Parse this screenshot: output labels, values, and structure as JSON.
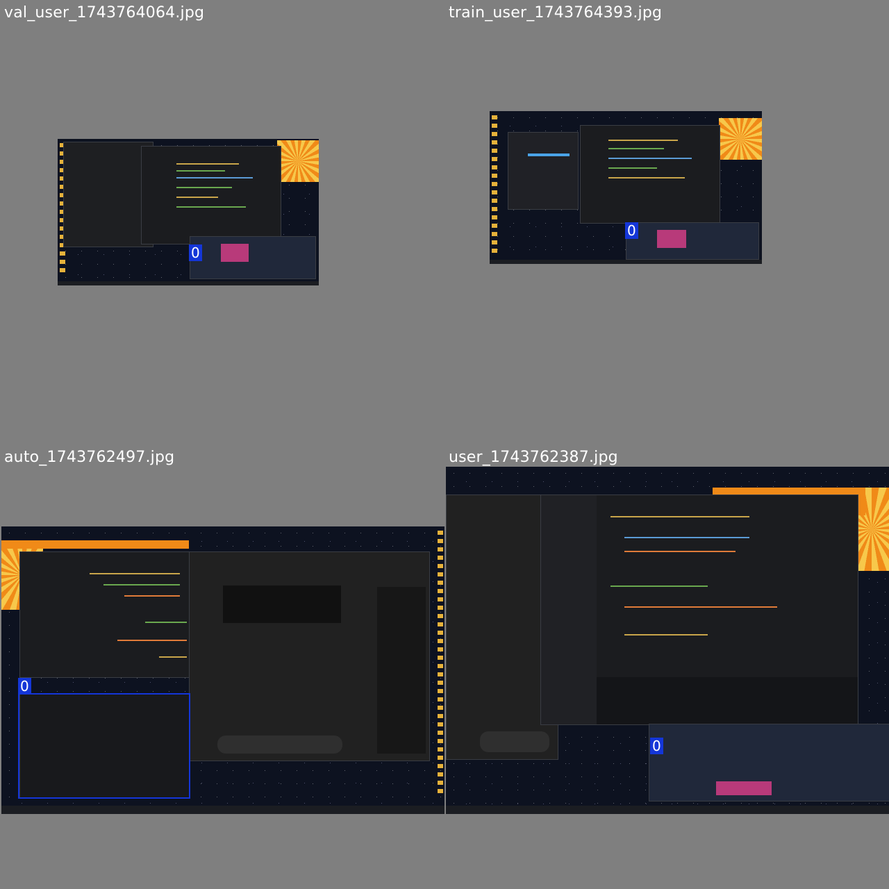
{
  "tiles": [
    {
      "caption": "val_user_1743764064.jpg",
      "box_label": "0"
    },
    {
      "caption": "train_user_1743764393.jpg",
      "box_label": "0"
    },
    {
      "caption": "auto_1743762497.jpg",
      "box_label": "0"
    },
    {
      "caption": "user_1743762387.jpg",
      "box_label": "0"
    }
  ],
  "colors": {
    "grid_background": "#7f7f7f",
    "box_color": "#1436d8",
    "desktop_dark": "#0d1220",
    "wallpaper_orange": "#f08a18"
  }
}
